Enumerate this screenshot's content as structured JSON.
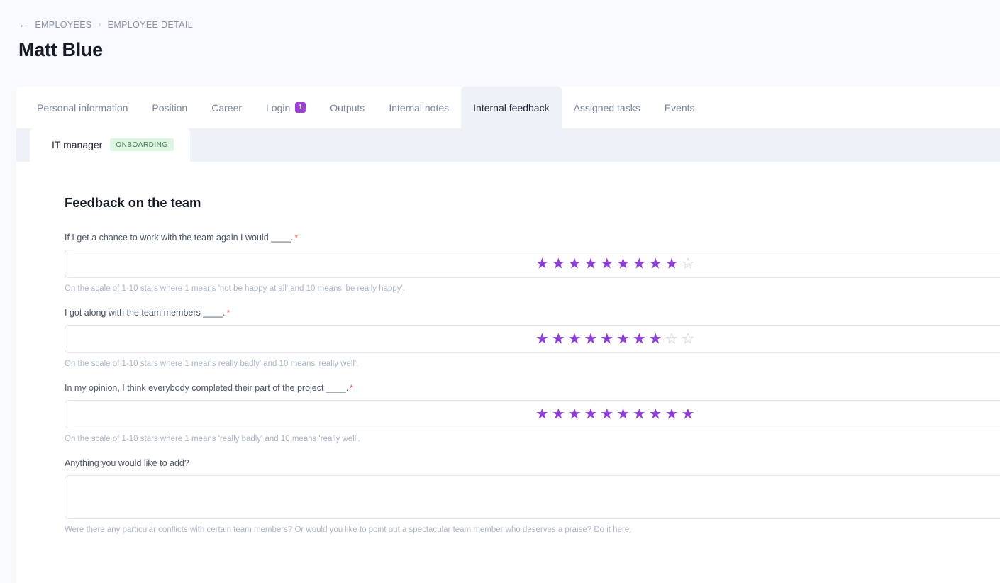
{
  "breadcrumb": {
    "back_icon": "arrow-left-icon",
    "parent": "EMPLOYEES",
    "separator": "›",
    "current": "EMPLOYEE DETAIL"
  },
  "page_title": "Matt Blue",
  "tabs": [
    {
      "label": "Personal information",
      "active": false,
      "badge": null
    },
    {
      "label": "Position",
      "active": false,
      "badge": null
    },
    {
      "label": "Career",
      "active": false,
      "badge": null
    },
    {
      "label": "Login",
      "active": false,
      "badge": "1"
    },
    {
      "label": "Outputs",
      "active": false,
      "badge": null
    },
    {
      "label": "Internal notes",
      "active": false,
      "badge": null
    },
    {
      "label": "Internal feedback",
      "active": true,
      "badge": null
    },
    {
      "label": "Assigned tasks",
      "active": false,
      "badge": null
    },
    {
      "label": "Events",
      "active": false,
      "badge": null
    }
  ],
  "subtab": {
    "label": "IT manager",
    "status": "ONBOARDING"
  },
  "section": {
    "title": "Feedback on the team"
  },
  "fields": [
    {
      "label": "If I get a chance to work with the team again I would ____.",
      "required": true,
      "type": "rating",
      "rating": 9,
      "max": 10,
      "value": "",
      "helper": "On the scale of 1-10 stars where 1 means 'not be happy at all' and 10 means 'be really happy'."
    },
    {
      "label": "I got along with the team members ____.",
      "required": true,
      "type": "rating",
      "rating": 8,
      "max": 10,
      "value": "",
      "helper": "On the scale of 1-10 stars where 1 means really badly' and 10 means 'really well'."
    },
    {
      "label": "In my opinion, I think everybody completed their part of the project ____.",
      "required": true,
      "type": "rating",
      "rating": 10,
      "max": 10,
      "value": "",
      "helper": "On the scale of 1-10 stars where 1 means 'really badly' and 10 means 'really well'."
    },
    {
      "label": "Anything you would like to add?",
      "required": false,
      "type": "textarea",
      "rating": null,
      "max": 0,
      "value": "",
      "helper": "Were there any particular conflicts with certain team members? Or would you like to point out a spectacular team member who deserves a praise? Do it here."
    }
  ],
  "colors": {
    "page_background": "#f7f9fc",
    "accent_purple": "#8e3fd6",
    "badge_purple": "#9b3fd6",
    "status_green_bg": "#ddf6e1",
    "status_green_text": "#4f7a5c",
    "required_red": "#f0584f",
    "star_empty": "#c2cbda",
    "tab_active_bg": "#eef1f7",
    "border": "#dfe6f1"
  },
  "icons": {
    "star_filled": "★",
    "star_empty": "☆",
    "arrow_left": "←"
  }
}
